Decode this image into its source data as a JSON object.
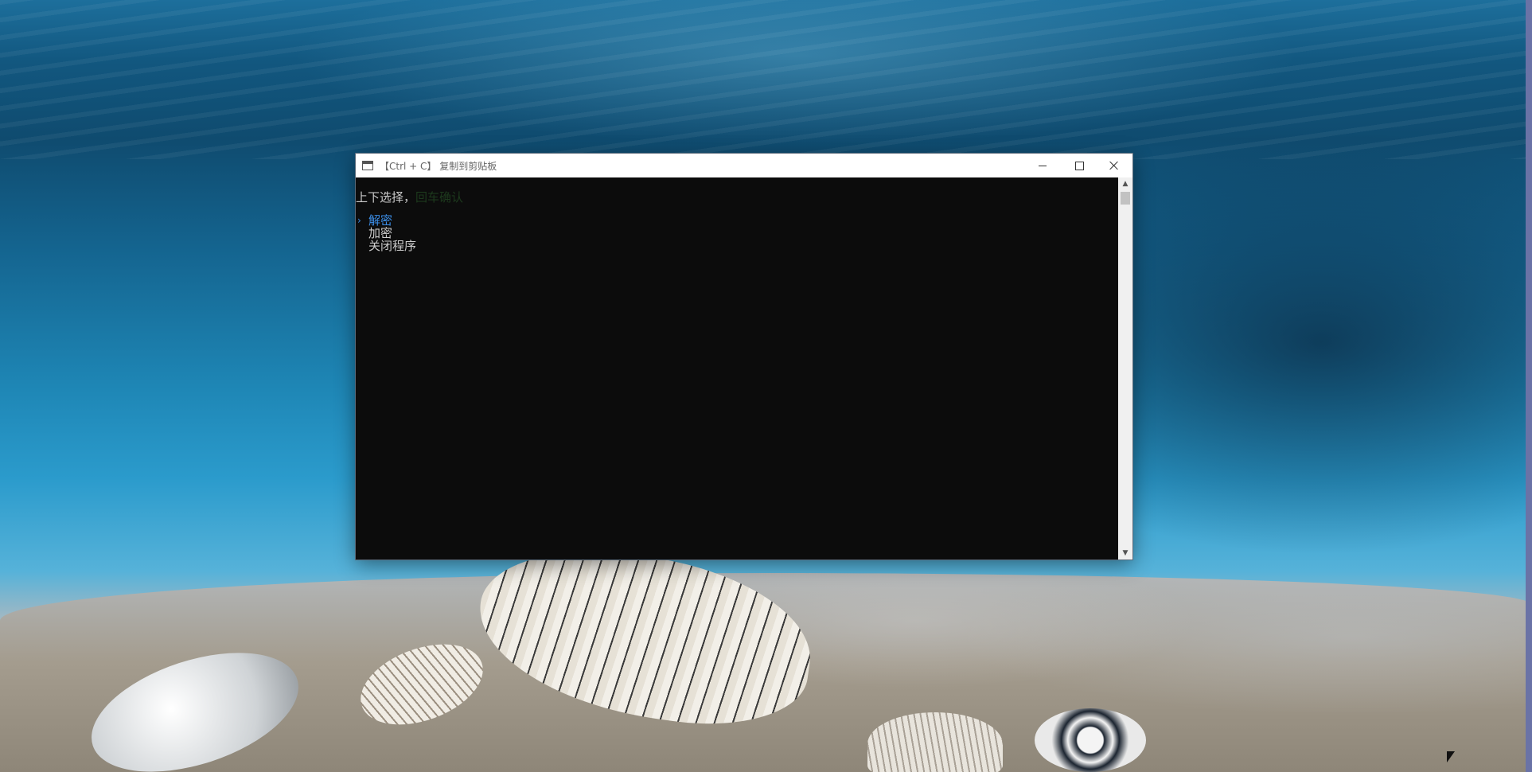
{
  "window": {
    "title": "【Ctrl + C】 复制到剪贴板",
    "icon": "console-app-icon",
    "controls": {
      "minimize": "minimize-icon",
      "maximize": "maximize-icon",
      "close": "close-icon"
    }
  },
  "console": {
    "prompt": "上下选择，",
    "prompt_hint": "回车确认",
    "menu": [
      {
        "label": "解密",
        "selected": true
      },
      {
        "label": "加密",
        "selected": false
      },
      {
        "label": "关闭程序",
        "selected": false
      }
    ],
    "selection_marker": "›"
  },
  "colors": {
    "console_bg": "#0c0c0c",
    "console_text": "#cccccc",
    "selected_text": "#3b8ee8",
    "hint_text": "#1d3a1d"
  }
}
